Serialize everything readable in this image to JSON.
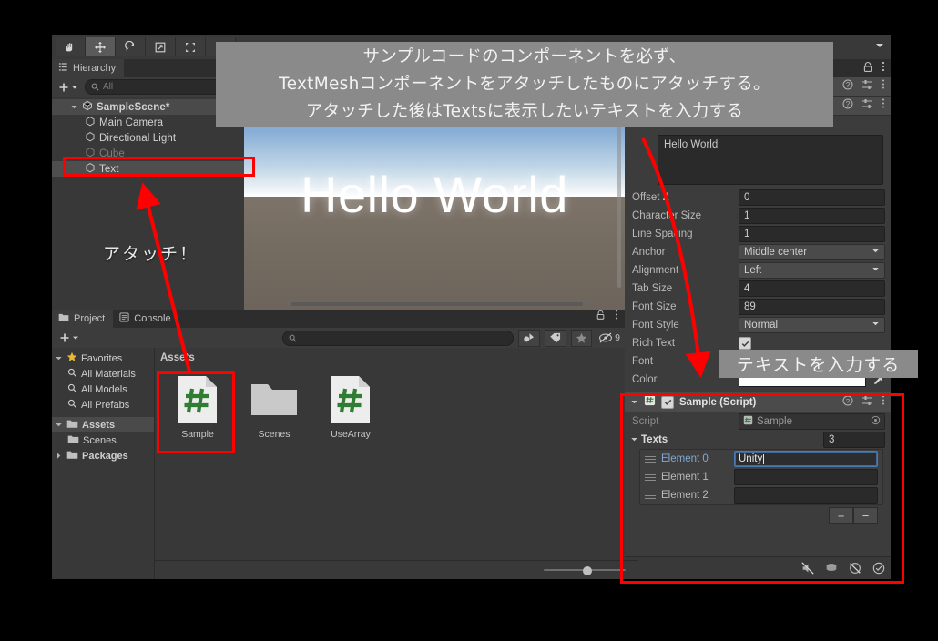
{
  "toolbar": {
    "tools": [
      {
        "name": "hand-tool",
        "icon": "hand",
        "active": false
      },
      {
        "name": "move-tool",
        "icon": "move",
        "active": true
      },
      {
        "name": "rotate-tool",
        "icon": "rotate",
        "active": false
      },
      {
        "name": "scale-tool",
        "icon": "scale",
        "active": false
      },
      {
        "name": "rect-tool",
        "icon": "rect",
        "active": false
      },
      {
        "name": "transform-tool",
        "icon": "transform",
        "active": false
      }
    ]
  },
  "hierarchy": {
    "tab_label": "Hierarchy",
    "search_placeholder": "All",
    "scene_name": "SampleScene*",
    "objects": [
      {
        "label": "Main Camera",
        "dim": false,
        "selected": false
      },
      {
        "label": "Directional Light",
        "dim": false,
        "selected": false
      },
      {
        "label": "Cube",
        "dim": true,
        "selected": false
      },
      {
        "label": "Text",
        "dim": false,
        "selected": true
      }
    ]
  },
  "scene": {
    "display_text": "Hello World"
  },
  "inspector": {
    "text_mesh": {
      "label": "Text",
      "value": "Hello World",
      "properties": [
        {
          "label": "Offset Z",
          "value": "0",
          "type": "text"
        },
        {
          "label": "Character Size",
          "value": "1",
          "type": "text"
        },
        {
          "label": "Line Spacing",
          "value": "1",
          "type": "text"
        },
        {
          "label": "Anchor",
          "value": "Middle center",
          "type": "dropdown"
        },
        {
          "label": "Alignment",
          "value": "Left",
          "type": "dropdown"
        },
        {
          "label": "Tab Size",
          "value": "4",
          "type": "text"
        },
        {
          "label": "Font Size",
          "value": "89",
          "type": "text"
        },
        {
          "label": "Font Style",
          "value": "Normal",
          "type": "dropdown"
        },
        {
          "label": "Rich Text",
          "value": "",
          "type": "checkbox"
        },
        {
          "label": "Font",
          "value": "",
          "type": "object"
        },
        {
          "label": "Color",
          "value": "#FFFFFF",
          "type": "color"
        }
      ]
    },
    "sample_script": {
      "title": "Sample (Script)",
      "enabled": true,
      "script_label": "Script",
      "script_value": "Sample",
      "array_label": "Texts",
      "array_size": "3",
      "elements": [
        {
          "label": "Element 0",
          "value": "Unity",
          "editing": true
        },
        {
          "label": "Element 1",
          "value": "",
          "editing": false
        },
        {
          "label": "Element 2",
          "value": "",
          "editing": false
        }
      ],
      "add_button": "+",
      "remove_button": "−"
    }
  },
  "project": {
    "tabs": [
      {
        "label": "Project",
        "active": true
      },
      {
        "label": "Console",
        "active": false
      }
    ],
    "tree": [
      {
        "label": "Favorites",
        "icon": "star-icon",
        "level": 0,
        "expanded": true,
        "selected": false
      },
      {
        "label": "All Materials",
        "icon": "search-icon",
        "level": 1,
        "selected": false
      },
      {
        "label": "All Models",
        "icon": "search-icon",
        "level": 1,
        "selected": false
      },
      {
        "label": "All Prefabs",
        "icon": "search-icon",
        "level": 1,
        "selected": false
      },
      {
        "label": "Assets",
        "icon": "folder-icon",
        "level": 0,
        "expanded": true,
        "selected": true
      },
      {
        "label": "Scenes",
        "icon": "folder-icon",
        "level": 1,
        "selected": false
      },
      {
        "label": "Packages",
        "icon": "folder-icon",
        "level": 0,
        "expanded": false,
        "selected": false
      }
    ],
    "breadcrumb": "Assets",
    "assets": [
      {
        "name": "Sample",
        "type": "csharp",
        "selected": true
      },
      {
        "name": "Scenes",
        "type": "folder",
        "selected": false
      },
      {
        "name": "UseArray",
        "type": "csharp",
        "selected": false
      }
    ],
    "filter_count": "9"
  },
  "annotations": {
    "top_overlay": [
      "サンプルコードのコンポーネントを必ず、",
      "TextMeshコンポーネントをアタッチしたものにアタッチする。",
      "アタッチした後はTextsに表示したいテキストを入力する"
    ],
    "attach_label": "アタッチ！",
    "input_label": "テキストを入力する"
  },
  "colors": {
    "highlight_red": "#ff0000",
    "panel_bg": "#383838",
    "field_bg": "#2a2a2a",
    "selection_blue": "#4a7ab5",
    "csharp_green": "#2e7d32"
  }
}
